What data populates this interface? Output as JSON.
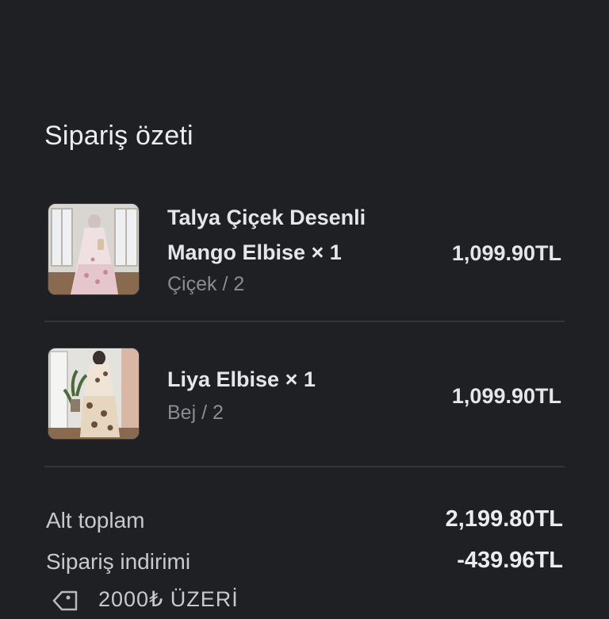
{
  "summary": {
    "title": "Sipariş özeti"
  },
  "items": [
    {
      "name_line1": "Talya Çiçek Desenli",
      "name_line2": "Mango Elbise × 1",
      "variant": "Çiçek / 2",
      "price": "1,099.90TL"
    },
    {
      "name_line1": "Liya Elbise × 1",
      "variant": "Bej / 2",
      "price": "1,099.90TL"
    }
  ],
  "totals": {
    "subtotal_label": "Alt toplam",
    "subtotal_value": "2,199.80TL",
    "discount_label": "Sipariş indirimi",
    "discount_value": "-439.96TL"
  },
  "discount": {
    "icon": "tag-icon",
    "code": "2000₺ ÜZERİ"
  },
  "colors": {
    "background": "#1f2023",
    "text": "#e8e8ea",
    "muted": "#8b8c91",
    "divider": "#35363a"
  }
}
